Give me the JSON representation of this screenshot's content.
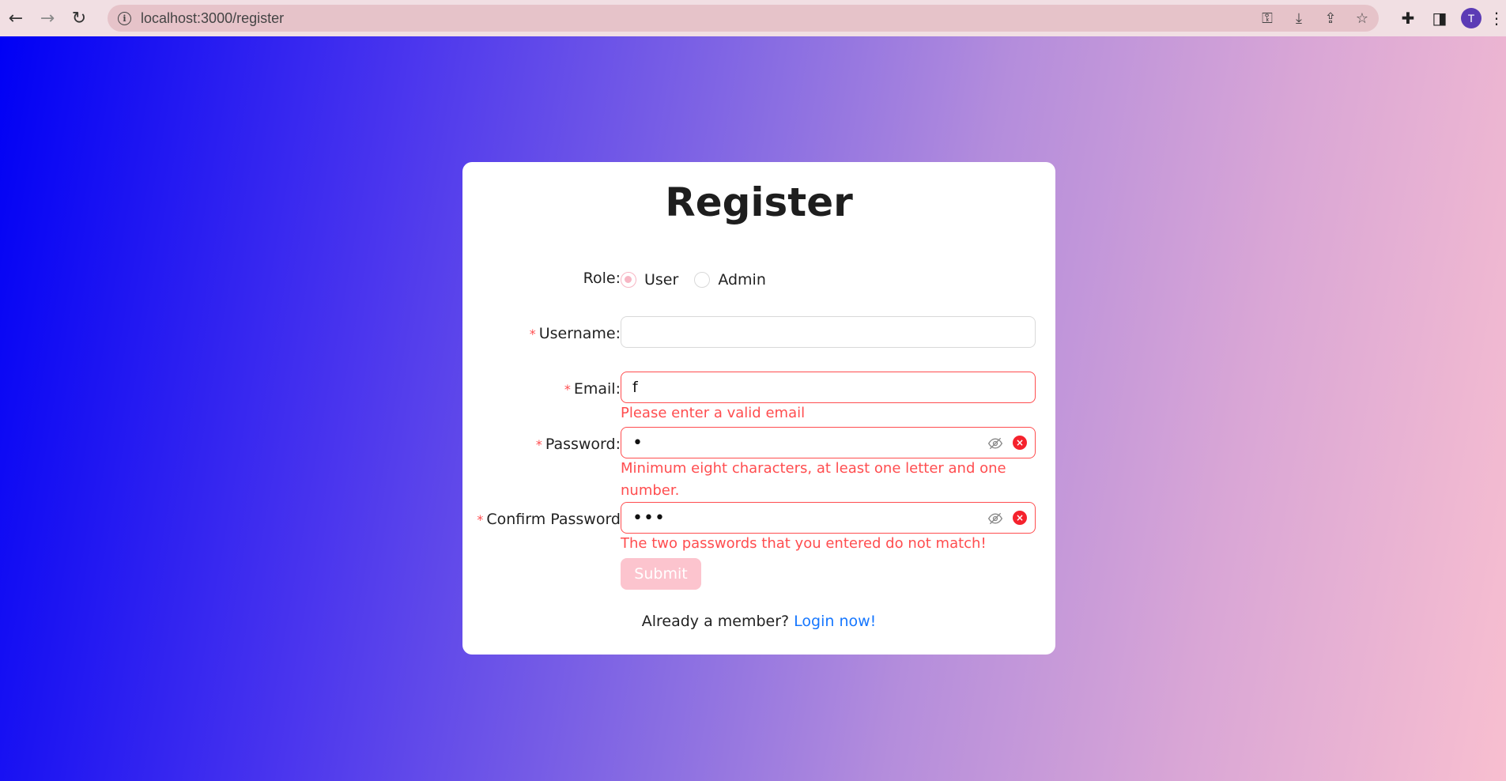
{
  "browser": {
    "url": "localhost:3000/register",
    "avatar_initial": "T"
  },
  "form": {
    "title": "Register",
    "role": {
      "label": "Role",
      "options": [
        "User",
        "Admin"
      ],
      "selected": "User"
    },
    "username": {
      "label": "Username",
      "value": ""
    },
    "email": {
      "label": "Email",
      "value": "f",
      "error": "Please enter a valid email"
    },
    "password": {
      "label": "Password",
      "masked_value": "•",
      "error": "Minimum eight characters, at least one letter and one number."
    },
    "confirm_password": {
      "label": "Confirm Password",
      "masked_value": "•••",
      "error": "The two passwords that you entered do not match!"
    },
    "submit_label": "Submit",
    "footer_text": "Already a member?",
    "footer_link": "Login now!"
  },
  "colors": {
    "accent": "#f7b6c4",
    "error": "#ff4d4f",
    "link": "#1677ff"
  }
}
